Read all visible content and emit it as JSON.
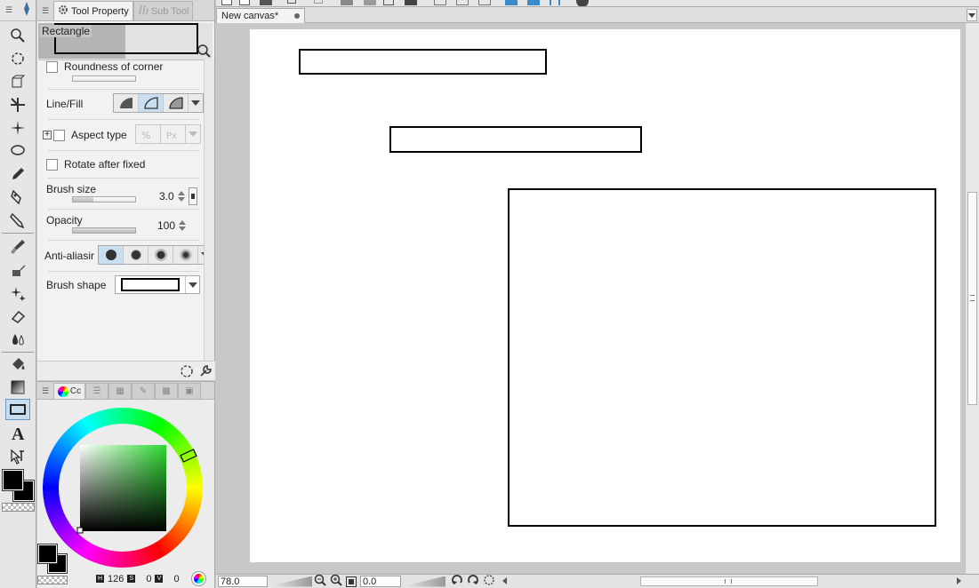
{
  "tool_property": {
    "tab_label": "Tool Property",
    "subtool_tab_label": "Sub Tool",
    "preview_name": "Rectangle",
    "roundness_label": "Roundness of corner",
    "line_fill_label": "Line/Fill",
    "aspect_label": "Aspect type",
    "rotate_label": "Rotate after fixed",
    "brush_size_label": "Brush size",
    "brush_size_value": "3.0",
    "opacity_label": "Opacity",
    "opacity_value": "100",
    "anti_alias_label": "Anti-aliasir",
    "brush_shape_label": "Brush shape"
  },
  "color_panel": {
    "tab_label": "Cc",
    "h_label": "H",
    "h_value": "126",
    "s_label": "S",
    "s_value": "0",
    "v_label": "V",
    "v_value": "0"
  },
  "canvas": {
    "tab_title": "New canvas*"
  },
  "status": {
    "zoom_value": "78.0",
    "rotation_value": "0.0"
  },
  "colors": {
    "accent": "#c9def0",
    "main_color": "#000000",
    "sub_color": "#000000"
  }
}
